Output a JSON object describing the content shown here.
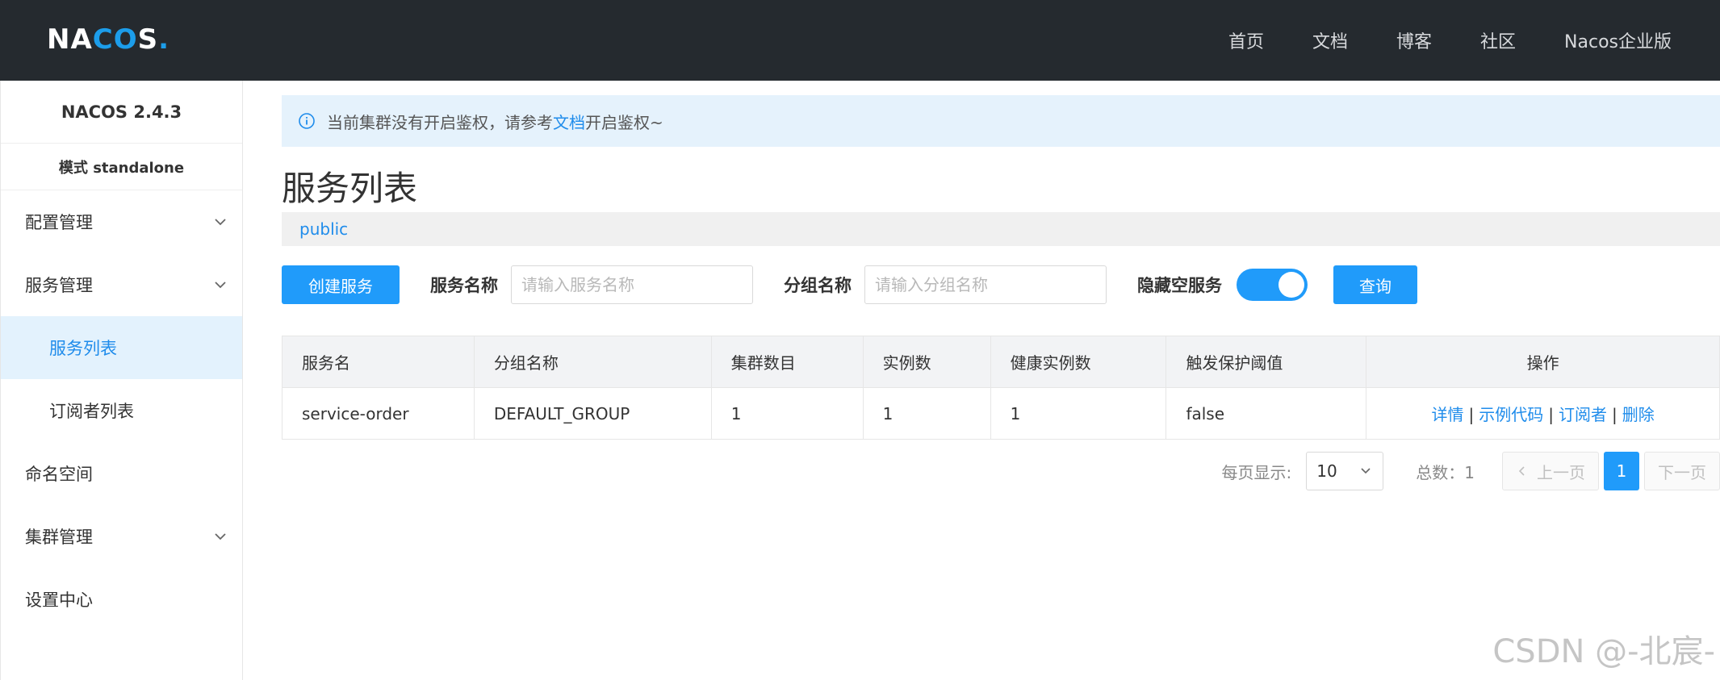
{
  "header": {
    "logo_text_a": "NA",
    "logo_text_b": "CO",
    "logo_text_c": "S",
    "logo_dot": ".",
    "nav": [
      "首页",
      "文档",
      "博客",
      "社区",
      "Nacos企业版"
    ]
  },
  "sidebar": {
    "version": "NACOS 2.4.3",
    "mode": "模式 standalone",
    "items": [
      {
        "label": "配置管理",
        "has_chevron": true
      },
      {
        "label": "服务管理",
        "has_chevron": true
      },
      {
        "label": "服务列表",
        "sub": true,
        "active": true
      },
      {
        "label": "订阅者列表",
        "sub": true
      },
      {
        "label": "命名空间"
      },
      {
        "label": "集群管理",
        "has_chevron": true
      },
      {
        "label": "设置中心"
      }
    ]
  },
  "notice": {
    "text_before": "当前集群没有开启鉴权，请参考",
    "link": "文档",
    "text_after": "开启鉴权~"
  },
  "page": {
    "title": "服务列表",
    "namespace": "public"
  },
  "filters": {
    "create_label": "创建服务",
    "service_name_label": "服务名称",
    "service_name_placeholder": "请输入服务名称",
    "group_name_label": "分组名称",
    "group_name_placeholder": "请输入分组名称",
    "hide_empty_label": "隐藏空服务",
    "hide_empty_on": true,
    "query_label": "查询"
  },
  "table": {
    "columns": [
      "服务名",
      "分组名称",
      "集群数目",
      "实例数",
      "健康实例数",
      "触发保护阈值",
      "操作"
    ],
    "rows": [
      {
        "cells": [
          "service-order",
          "DEFAULT_GROUP",
          "1",
          "1",
          "1",
          "false"
        ],
        "ops": [
          "详情",
          "示例代码",
          "订阅者",
          "删除"
        ]
      }
    ]
  },
  "pager": {
    "per_page_label": "每页显示:",
    "per_page_value": "10",
    "total_label": "总数：1",
    "prev_label": "上一页",
    "current_page": "1",
    "next_label": "下一页"
  },
  "watermark": "CSDN @-北宸-",
  "colors": {
    "topbar": "#252a2f",
    "accent": "#209bfa",
    "link": "#1f8ceb",
    "notice_bg": "#e5f2fc",
    "active_bg": "#e3f2fd"
  }
}
